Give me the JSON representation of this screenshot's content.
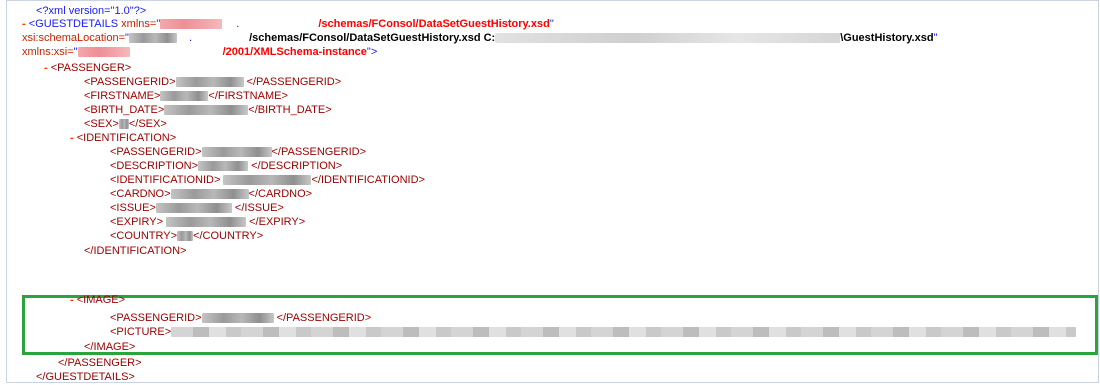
{
  "xml_decl": "<?xml version=\"1.0\"?>",
  "root": {
    "toggle": "-",
    "open_tag": "<GUESTDETAILS",
    "xmlns_attr": "xmlns=",
    "quote": "\"",
    "dot": ".",
    "xmlns_tail": "/schemas/FConsol/DataSetGuestHistory.xsd",
    "schema_location_attr": "xsi:schemaLocation=",
    "schema_location_tail1": "/schemas/FConsol/DataSetGuestHistory.xsd C:",
    "schema_location_tail2": "\\GuestHistory.xsd",
    "xmlns_xsi_attr": "xmlns:xsi=",
    "xmlns_xsi_tail": "/2001/XMLSchema-instance",
    "close_bracket": "\">",
    "end_tag": "</GUESTDETAILS>"
  },
  "passenger": {
    "toggle": "-",
    "open_tag": "<PASSENGER>",
    "end_tag": "</PASSENGER>",
    "fields": [
      {
        "open": "<PASSENGERID>",
        "close": "</PASSENGERID>"
      },
      {
        "open": "<FIRSTNAME>",
        "close": "</FIRSTNAME>"
      },
      {
        "open": "<BIRTH_DATE>",
        "close": "</BIRTH_DATE>"
      },
      {
        "open": "<SEX>",
        "close": "</SEX>"
      }
    ]
  },
  "identification": {
    "toggle": "-",
    "open_tag": "<IDENTIFICATION>",
    "end_tag": "</IDENTIFICATION>",
    "fields": [
      {
        "open": "<PASSENGERID>",
        "close": "</PASSENGERID>"
      },
      {
        "open": "<DESCRIPTION>",
        "close": "</DESCRIPTION>"
      },
      {
        "open": "<IDENTIFICATIONID>",
        "close": "</IDENTIFICATIONID>"
      },
      {
        "open": "<CARDNO>",
        "close": "</CARDNO>"
      },
      {
        "open": "<ISSUE>",
        "close": "</ISSUE>"
      },
      {
        "open": "<EXPIRY>",
        "close": "</EXPIRY>"
      },
      {
        "open": "<COUNTRY>",
        "close": "</COUNTRY>"
      }
    ]
  },
  "image": {
    "toggle": "-",
    "open_tag": "<IMAGE>",
    "end_tag": "</IMAGE>",
    "passengerid_open": "<PASSENGERID>",
    "passengerid_close": "</PASSENGERID>",
    "picture_open": "<PICTURE>"
  },
  "colors": {
    "highlight": "#2aa53d",
    "tag": "#990000",
    "bracket": "#1a1aff",
    "value": "#ff0000"
  }
}
